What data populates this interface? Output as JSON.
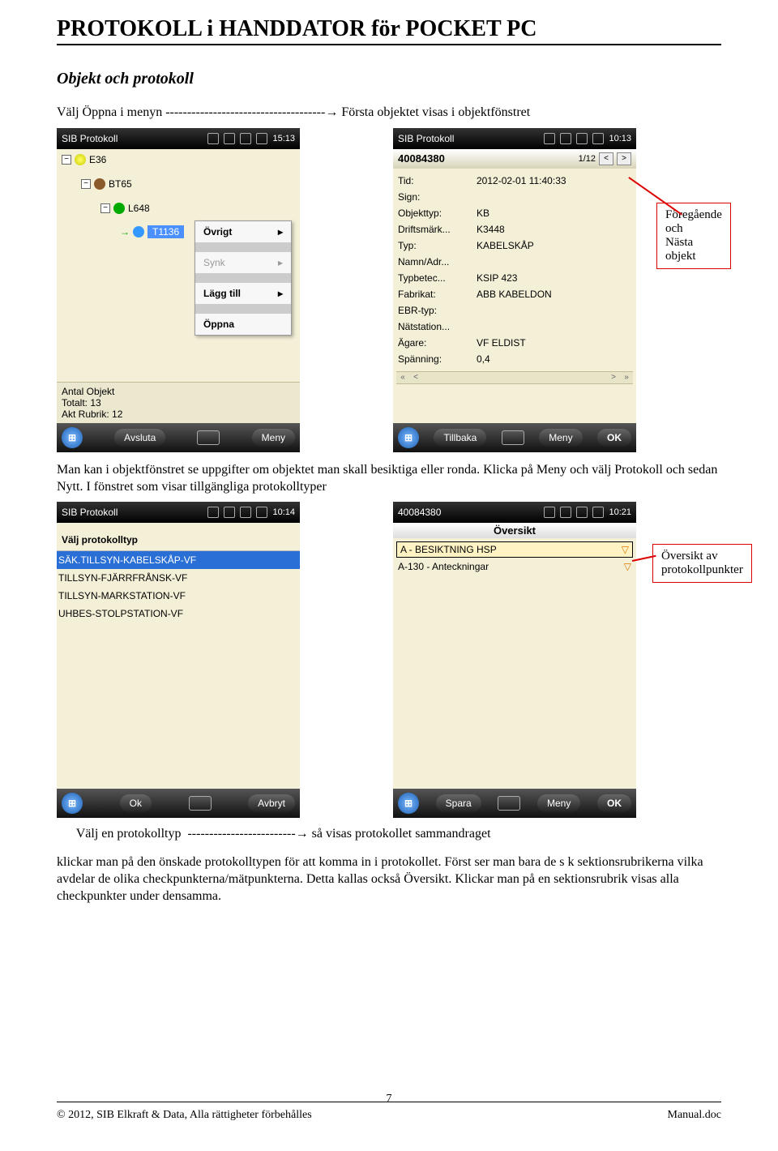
{
  "page_title": "PROTOKOLL i HANDDATOR för POCKET PC",
  "section1_heading": "Objekt och protokoll",
  "para1_pre": "Välj Öppna i menyn -------------------------------------",
  "para1_post": " Första objektet visas i objektfönstret",
  "callout1_l1": "Föregående och",
  "callout1_l2": "Nästa objekt",
  "screen1": {
    "app": "SIB Protokoll",
    "time": "15:13",
    "tree": {
      "root": "E36",
      "n1": "BT65",
      "n2": "L648",
      "n3": "T1136"
    },
    "menu": {
      "ovrigt": "Övrigt",
      "synk": "Synk",
      "lagg": "Lägg till",
      "oppna": "Öppna"
    },
    "status": {
      "l1": "Antal Objekt",
      "l2": "Totalt: 13",
      "l3": "Akt Rubrik: 12"
    },
    "bottom": {
      "left": "Avsluta",
      "right": "Meny"
    }
  },
  "screen2": {
    "app": "SIB Protokoll",
    "time": "10:13",
    "id": "40084380",
    "pager": "1/12",
    "kv": {
      "tid": "Tid:",
      "tid_v": "2012-02-01 11:40:33",
      "sign": "Sign:",
      "obj": "Objekttyp:",
      "obj_v": "KB",
      "drift": "Driftsmärk...",
      "drift_v": "K3448",
      "typ": "Typ:",
      "typ_v": "KABELSKÅP",
      "namn": "Namn/Adr...",
      "typb": "Typbetec...",
      "typb_v": "KSIP 423",
      "fab": "Fabrikat:",
      "fab_v": "ABB KABELDON",
      "ebr": "EBR-typ:",
      "nat": "Nätstation...",
      "agare": "Ägare:",
      "agare_v": "VF ELDIST",
      "sp": "Spänning:",
      "sp_v": "0,4"
    },
    "bottom": {
      "left": "Tillbaka",
      "right": "Meny",
      "ok": "OK"
    }
  },
  "para2": "Man kan i objektfönstret se uppgifter om objektet man skall besiktiga eller ronda. Klicka på Meny och välj Protokoll och sedan Nytt. I fönstret som visar tillgängliga protokolltyper",
  "callout2_l1": "Översikt av",
  "callout2_l2": "protokollpunkter",
  "screen3": {
    "app": "SIB Protokoll",
    "time": "10:14",
    "heading": "Välj protokolltyp",
    "items": {
      "i1": "SÄK.TILLSYN-KABELSKÅP-VF",
      "i2": "TILLSYN-FJÄRRFRÅNSK-VF",
      "i3": "TILLSYN-MARKSTATION-VF",
      "i4": "UHBES-STOLPSTATION-VF"
    },
    "bottom": {
      "left": "Ok",
      "right": "Avbryt"
    }
  },
  "screen4": {
    "app": "40084380",
    "time": "10:21",
    "title": "Översikt",
    "row1": "A - BESIKTNING HSP",
    "row2": "A-130 - Anteckningar",
    "bottom": {
      "left": "Spara",
      "right": "Meny",
      "ok": "OK"
    }
  },
  "para3_pre": "      Välj en protokolltyp  -------------------------",
  "para3_post": " så visas protokollet sammandraget",
  "para4": "klickar man på den önskade protokolltypen för att komma in i protokollet. Först ser man bara de s k sektionsrubrikerna vilka avdelar de olika checkpunkterna/mätpunkterna. Detta kallas också Översikt. Klickar man på en sektionsrubrik visas alla checkpunkter under densamma.",
  "footer": {
    "left": "© 2012, SIB Elkraft & Data, Alla rättigheter förbehålles",
    "center": "7",
    "right": "Manual.doc"
  },
  "chart_data": {
    "type": "table",
    "note": "No chart present; document page with embedded device screenshots."
  }
}
